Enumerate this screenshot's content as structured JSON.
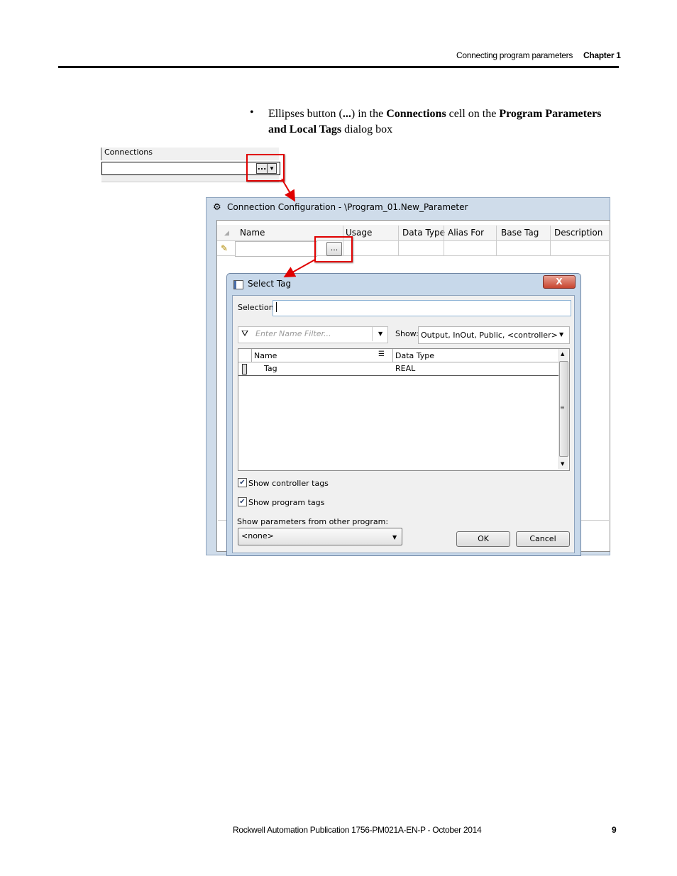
{
  "page_header": {
    "section": "Connecting program parameters",
    "chapter": "Chapter 1"
  },
  "body": {
    "bullet_parts": [
      "Ellipses button (",
      "...",
      ") in the ",
      "Connections",
      " cell on the ",
      "Program Parameters and Local Tags",
      " dialog box"
    ]
  },
  "connections_snippet": {
    "header": "Connections",
    "button": "..."
  },
  "connection_config": {
    "title": "Connection Configuration  - \\Program_01.New_Parameter",
    "columns": [
      "Name",
      "Usage",
      "Data Type",
      "Alias For",
      "Base Tag",
      "Description"
    ],
    "ellipsis": "..."
  },
  "select_tag": {
    "title": "Select Tag",
    "close": "X",
    "selection_label": "Selection:",
    "filter_placeholder": "Enter Name Filter...",
    "show_label": "Show:",
    "show_value": "Output, InOut, Public, <controller>",
    "table_headers": [
      "Name",
      "Data Type"
    ],
    "rows": [
      {
        "name": "Tag",
        "type": "REAL"
      }
    ],
    "show_controller_tags": "Show controller tags",
    "show_program_tags": "Show program tags",
    "show_params_label": "Show parameters from other program:",
    "program_value": "<none>",
    "ok": "OK",
    "cancel": "Cancel"
  },
  "footer": {
    "publication": "Rockwell Automation Publication 1756-PM021A-EN-P - October 2014",
    "page": "9"
  },
  "colors": {
    "highlight": "#e00000",
    "dialog_frame": "#c7d8ea"
  }
}
